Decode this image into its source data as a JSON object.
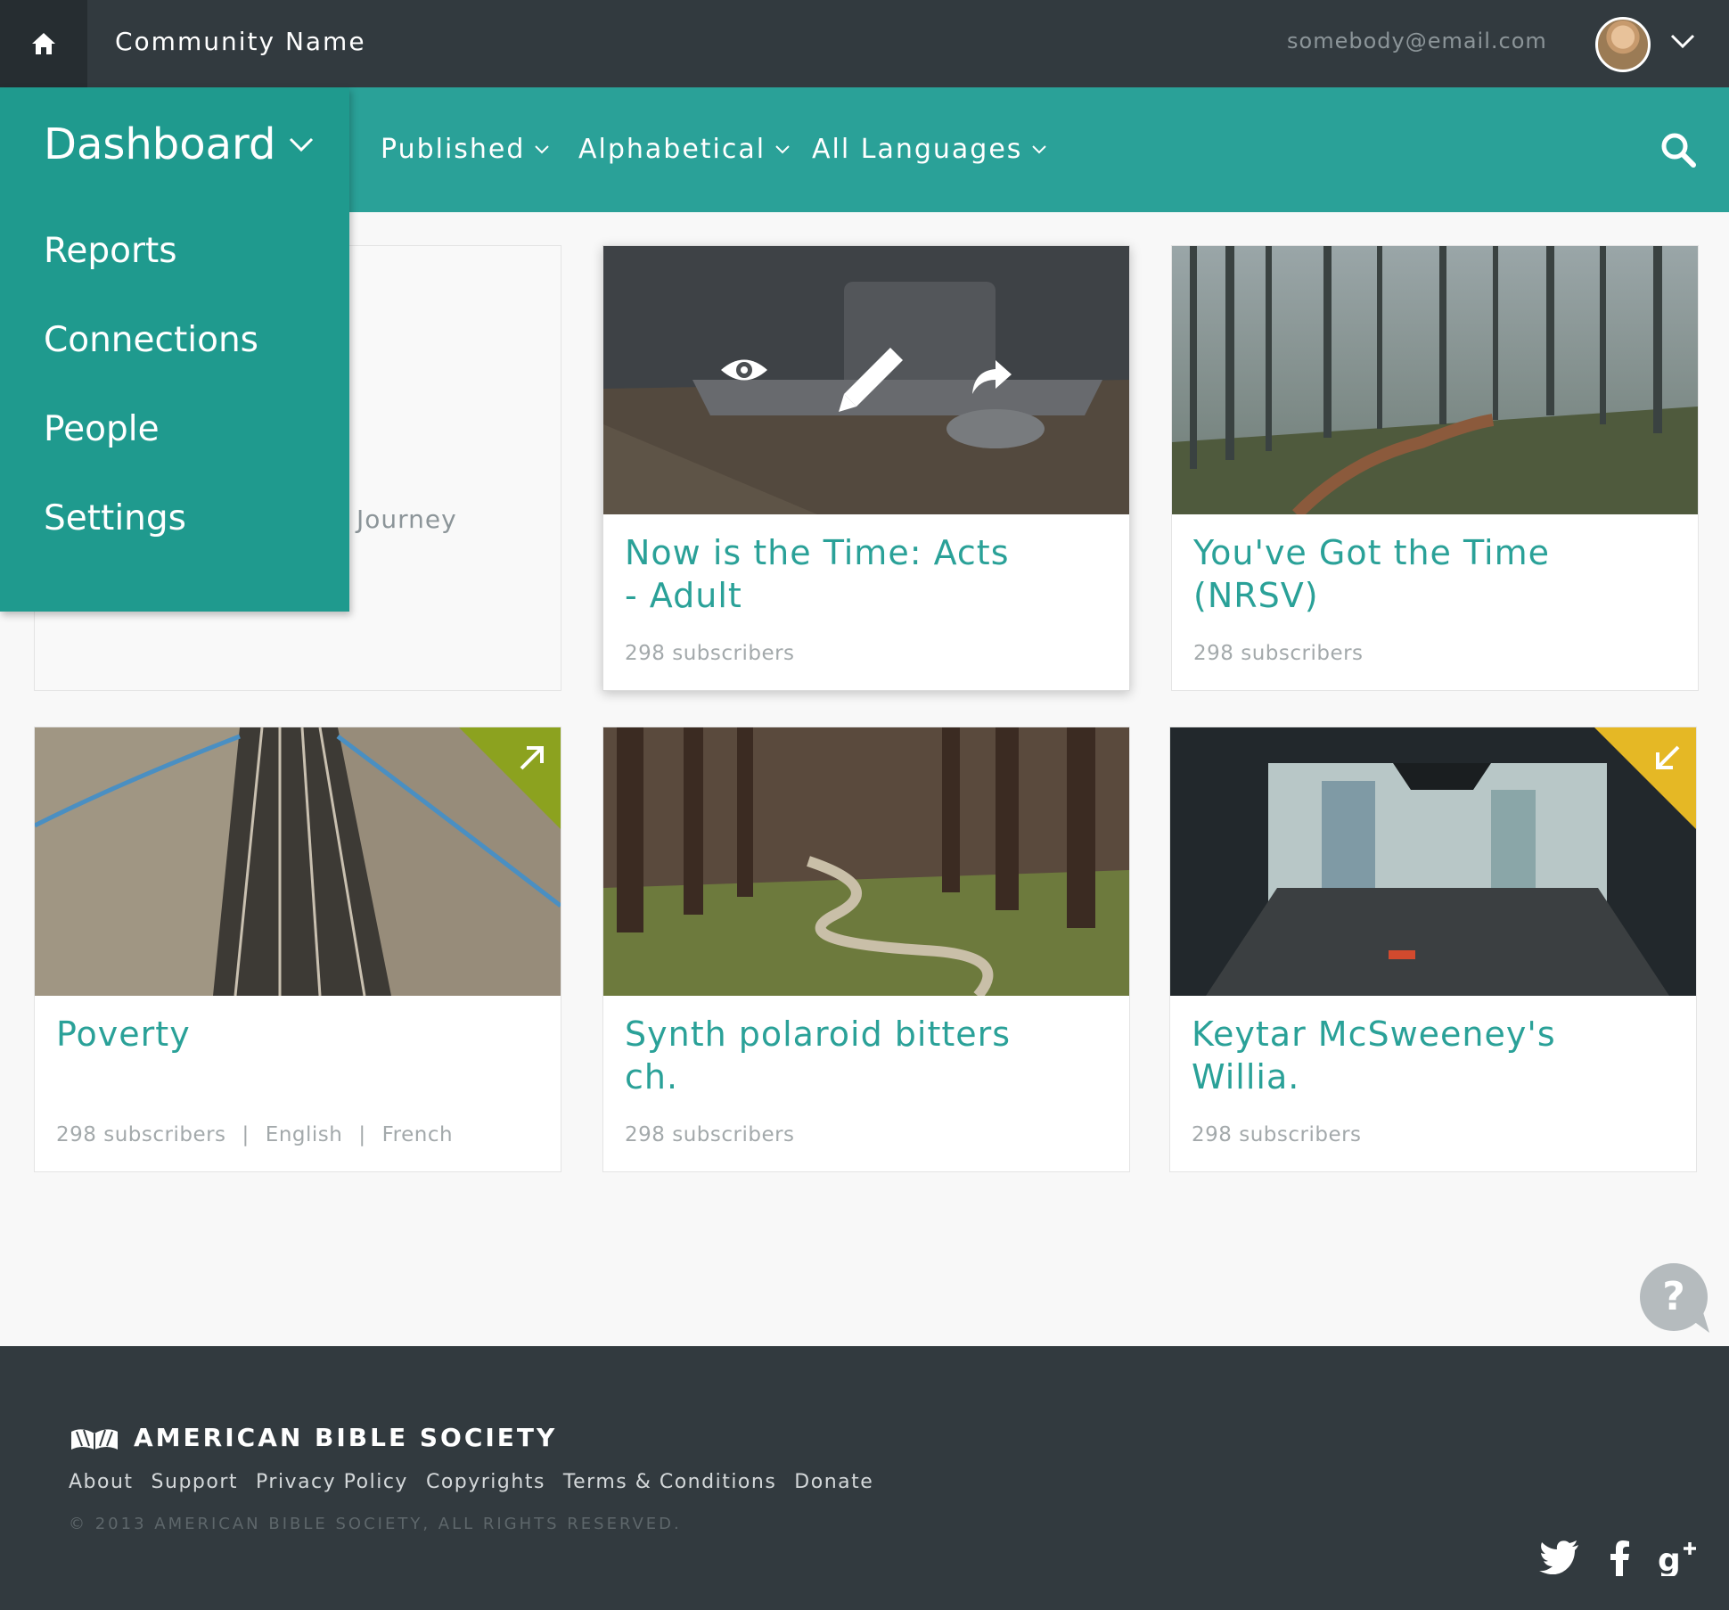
{
  "header": {
    "home_icon": "home-icon",
    "community_name": "Community Name",
    "user_email": "somebody@email.com",
    "avatar_icon": "user-avatar",
    "menu_chevron_icon": "chevron-down-icon"
  },
  "filters": {
    "items": [
      {
        "label": "Published"
      },
      {
        "label": "Alphabetical"
      },
      {
        "label": "All Languages"
      }
    ],
    "search_icon": "search-icon"
  },
  "dashboard_menu": {
    "title": "Dashboard",
    "items": [
      {
        "label": "Reports"
      },
      {
        "label": "Connections"
      },
      {
        "label": "People"
      },
      {
        "label": "Settings"
      }
    ]
  },
  "cards": [
    {
      "title": "",
      "partial_visible_text": "Journey"
    },
    {
      "title": "Now is the Time: Acts - Adult",
      "subscribers": "298 subscribers",
      "overlay_actions": [
        "view-icon",
        "edit-icon",
        "share-icon"
      ]
    },
    {
      "title": "You've Got the Time (NRSV)",
      "subscribers": "298 subscribers"
    },
    {
      "title": "Poverty",
      "subscribers": "298 subscribers",
      "languages": [
        "English",
        "French"
      ],
      "corner_badge": {
        "color": "#8ca21f",
        "icon": "arrow-up-right-icon"
      }
    },
    {
      "title": "Synth polaroid bitters ch.",
      "subscribers": "298 subscribers"
    },
    {
      "title": "Keytar McSweeney's Willia.",
      "subscribers": "298 subscribers",
      "corner_badge": {
        "color": "#e5b825",
        "icon": "arrow-down-left-icon"
      }
    }
  ],
  "help_icon": "help-bubble-icon",
  "footer": {
    "brand_name": "AMERICAN BIBLE SOCIETY",
    "brand_icon": "open-book-logo",
    "links": [
      "About",
      "Support",
      "Privacy Policy",
      "Copyrights",
      "Terms & Conditions",
      "Donate"
    ],
    "copyright": "© 2013 AMERICAN BIBLE SOCIETY, ALL RIGHTS RESERVED.",
    "social_icons": [
      "twitter-icon",
      "facebook-icon",
      "google-plus-icon"
    ]
  },
  "colors": {
    "topbar": "#323a3f",
    "teal": "#2aa198",
    "menu_teal": "#1f9a8e",
    "footer": "#323a3f",
    "badge_green": "#8ca21f",
    "badge_yellow": "#e5b825"
  }
}
